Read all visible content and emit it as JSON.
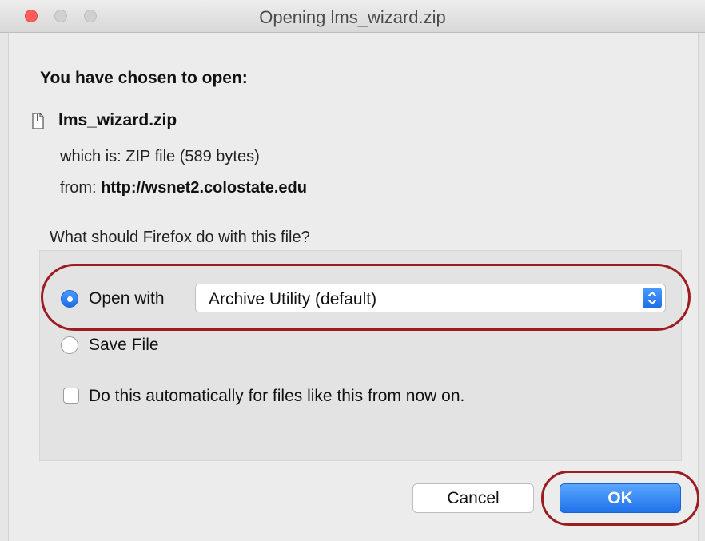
{
  "window": {
    "title": "Opening lms_wizard.zip"
  },
  "dialog": {
    "heading": "You have chosen to open:",
    "file_name": "lms_wizard.zip",
    "which_is_label": "which is:",
    "which_is_value": "ZIP file (589 bytes)",
    "from_label": "from:",
    "from_value": "http://wsnet2.colostate.edu",
    "question": "What should Firefox do with this file?"
  },
  "options": {
    "open_with_label": "Open with",
    "open_with_selected": true,
    "application": "Archive Utility (default)",
    "save_file_label": "Save File",
    "save_file_selected": false,
    "auto_label": "Do this automatically for files like this from now on.",
    "auto_checked": false
  },
  "buttons": {
    "cancel": "Cancel",
    "ok": "OK"
  },
  "colors": {
    "accent": "#2d7cf2",
    "annotation": "#9c1d20",
    "close_button": "#fb5f57"
  }
}
